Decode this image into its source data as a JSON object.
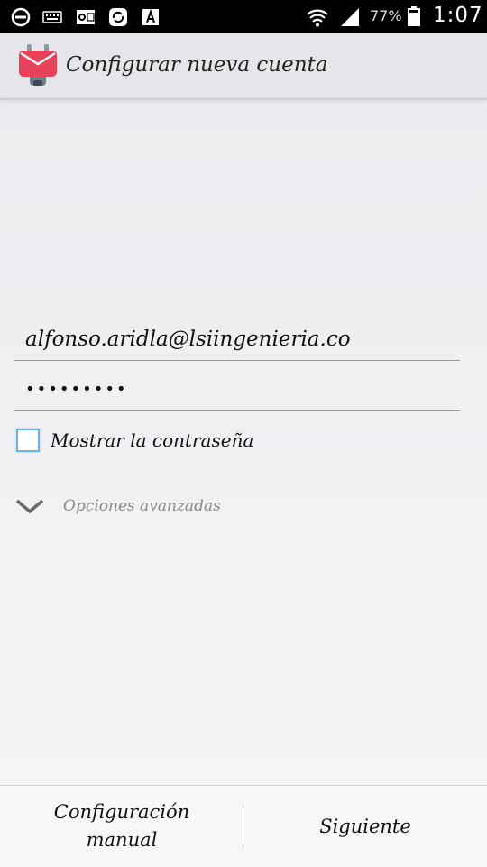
{
  "status_bar": {
    "battery_percent": "77%",
    "time": "1:07",
    "icons": [
      "do-not-disturb-icon",
      "keyboard-icon",
      "outlook-icon",
      "sync-icon",
      "text-icon",
      "wifi-icon",
      "signal-icon",
      "battery-icon"
    ]
  },
  "action_bar": {
    "title": "Configurar nueva cuenta",
    "logo": "k9-mail-icon"
  },
  "form": {
    "email_value": "alfonso.aridla@lsiingenieria.co",
    "password_value": "•••••••••",
    "show_password_label": "Mostrar la contraseña",
    "show_password_checked": false,
    "advanced_options_label": "Opciones avanzadas"
  },
  "bottom_bar": {
    "manual_line1": "Configuración",
    "manual_line2": "manual",
    "next_label": "Siguiente"
  },
  "colors": {
    "logo_red": "#e8425b",
    "checkbox_border": "#6fb2e2"
  }
}
